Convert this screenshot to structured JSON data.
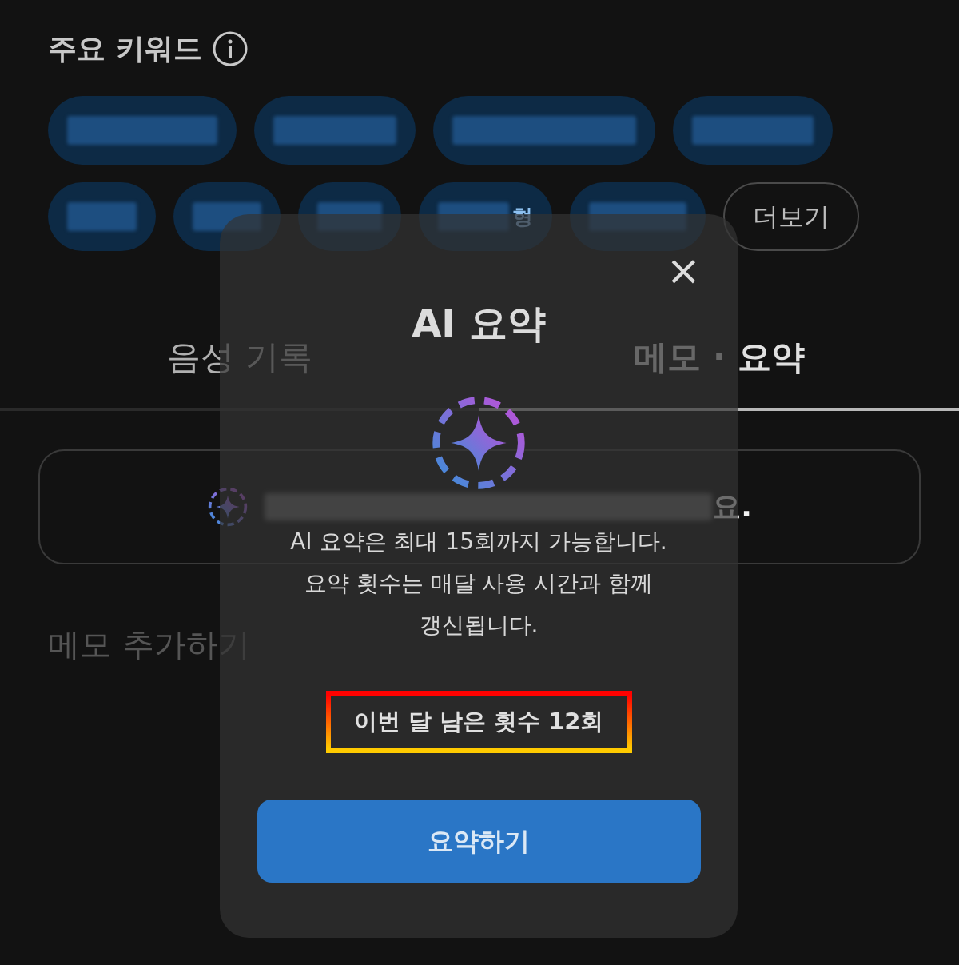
{
  "keywords": {
    "title": "주요 키워드",
    "chips": [
      {
        "kind": "blurred"
      },
      {
        "kind": "blurred"
      },
      {
        "kind": "blurred"
      },
      {
        "kind": "blurred"
      },
      {
        "kind": "blurred"
      },
      {
        "kind": "blurred"
      },
      {
        "kind": "blurred"
      },
      {
        "kind": "partial",
        "visible_text": "형"
      },
      {
        "kind": "blurred"
      }
    ],
    "more_button": "더보기"
  },
  "tabs": [
    {
      "label": "음성 기록",
      "selected": false
    },
    {
      "label": "메모 · 요약",
      "selected": true
    }
  ],
  "summary_card": {
    "visible_text": "요."
  },
  "memo": {
    "placeholder": "메모 추가하기"
  },
  "dialog": {
    "title": "AI 요약",
    "close": "×",
    "description": [
      "AI 요약은 최대 15회까지 가능합니다.",
      "요약 횟수는 매달 사용 시간과 함께",
      "갱신됩니다."
    ],
    "remaining": "이번 달 남은 횟수 12회",
    "highlighted": true,
    "button": "요약하기"
  }
}
